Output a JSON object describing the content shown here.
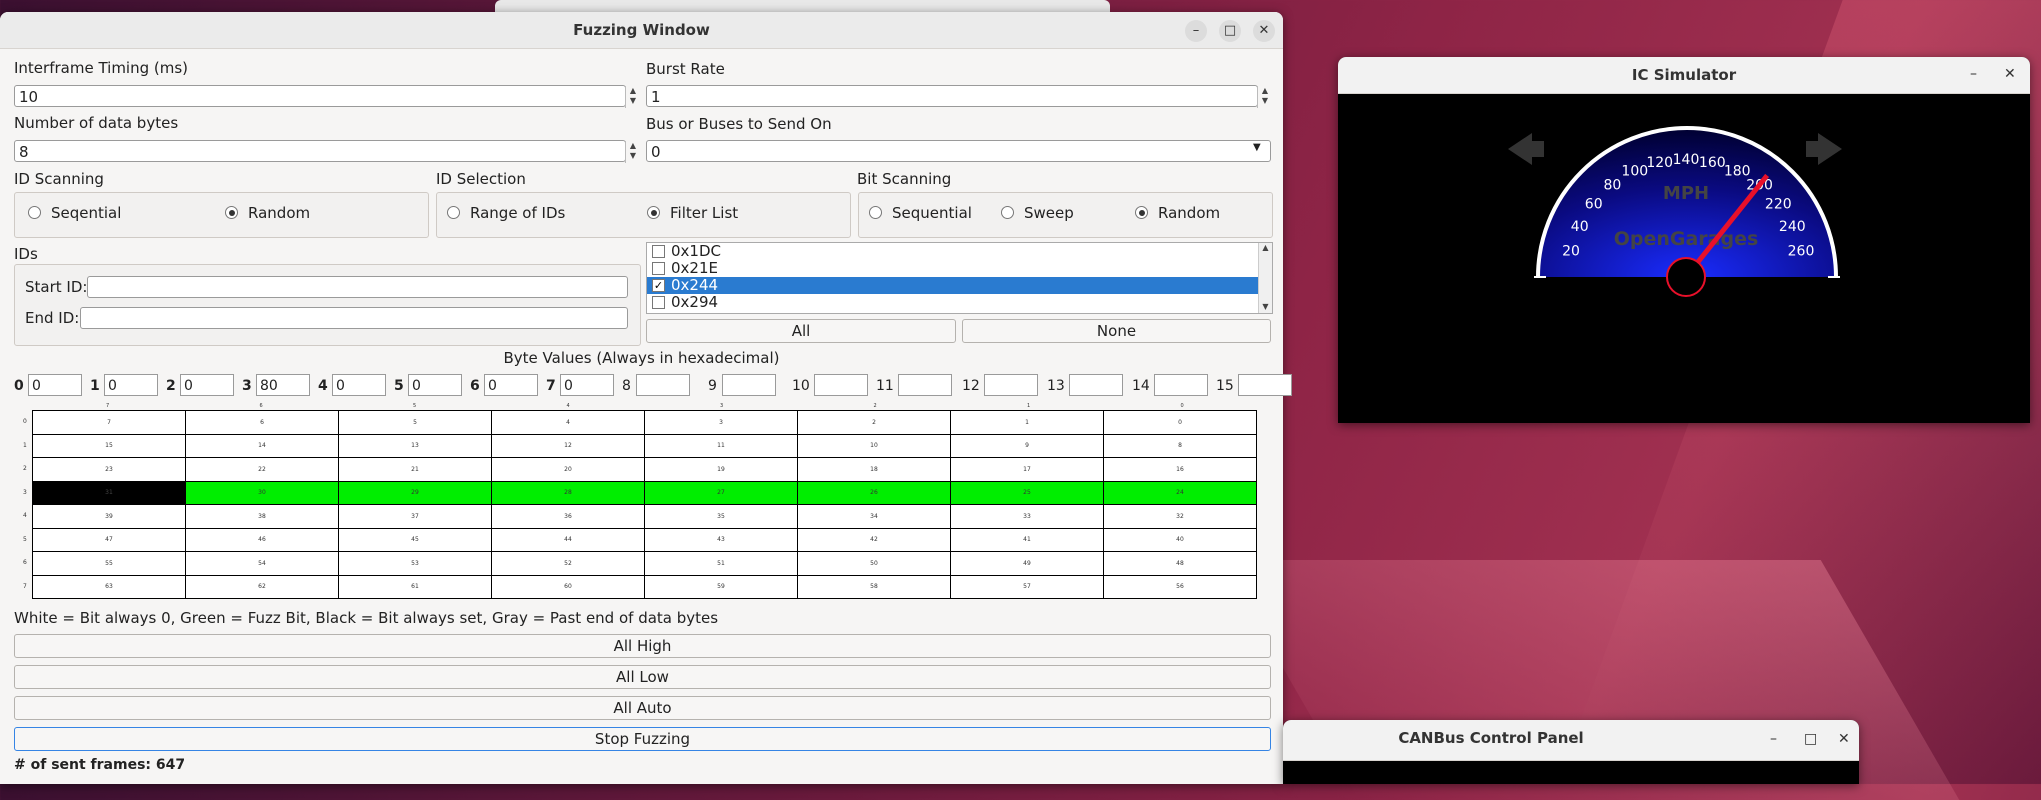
{
  "fuzz_window": {
    "title": "Fuzzing Window",
    "interframe_label": "Interframe Timing (ms)",
    "interframe_value": "10",
    "burst_label": "Burst Rate",
    "burst_value": "1",
    "num_bytes_label": "Number of data bytes",
    "num_bytes_value": "8",
    "bus_label": "Bus or Buses to Send On",
    "bus_value": "0",
    "id_scanning": {
      "label": "ID Scanning",
      "opt1": "Seqential",
      "opt2": "Random",
      "selected": "Random"
    },
    "id_selection": {
      "label": "ID Selection",
      "opt1": "Range of IDs",
      "opt2": "Filter List",
      "selected": "Filter List"
    },
    "bit_scanning": {
      "label": "Bit Scanning",
      "opt1": "Sequential",
      "opt2": "Sweep",
      "opt3": "Random",
      "selected": "Random"
    },
    "ids": {
      "label": "IDs",
      "start_label": "Start ID:",
      "end_label": "End ID:"
    },
    "id_list": [
      {
        "id": "0x1DC",
        "checked": false,
        "selected": false
      },
      {
        "id": "0x21E",
        "checked": false,
        "selected": false
      },
      {
        "id": "0x244",
        "checked": true,
        "selected": true
      },
      {
        "id": "0x294",
        "checked": false,
        "selected": false
      }
    ],
    "all_label": "All",
    "none_label": "None",
    "byte_values_title": "Byte Values (Always in hexadecimal)",
    "byte_values": [
      {
        "idx": "0",
        "val": "0"
      },
      {
        "idx": "1",
        "val": "0"
      },
      {
        "idx": "2",
        "val": "0"
      },
      {
        "idx": "3",
        "val": "80"
      },
      {
        "idx": "4",
        "val": "0"
      },
      {
        "idx": "5",
        "val": "0"
      },
      {
        "idx": "6",
        "val": "0"
      },
      {
        "idx": "7",
        "val": "0"
      },
      {
        "idx": "8",
        "val": ""
      },
      {
        "idx": "9",
        "val": ""
      },
      {
        "idx": "10",
        "val": ""
      },
      {
        "idx": "11",
        "val": ""
      },
      {
        "idx": "12",
        "val": ""
      },
      {
        "idx": "13",
        "val": ""
      },
      {
        "idx": "14",
        "val": ""
      },
      {
        "idx": "15",
        "val": ""
      }
    ],
    "legend": "White = Bit always 0, Green = Fuzz Bit, Black = Bit always set, Gray = Past end of data bytes",
    "all_high": "All High",
    "all_low": "All Low",
    "all_auto": "All Auto",
    "stop": "Stop Fuzzing",
    "sent_frames": "# of sent frames: 647"
  },
  "ic_sim": {
    "title": "IC Simulator",
    "unit": "MPH",
    "brand": "OpenGarages",
    "speed_labels": [
      "20",
      "40",
      "60",
      "80",
      "100",
      "120",
      "140",
      "160",
      "180",
      "200",
      "220",
      "240",
      "260"
    ],
    "needle_speed": 200
  },
  "can_panel": {
    "title": "CANBus Control Panel"
  },
  "colors": {
    "fuzz": "#00ee00",
    "set": "#000000",
    "selection": "#2a7bd0"
  }
}
